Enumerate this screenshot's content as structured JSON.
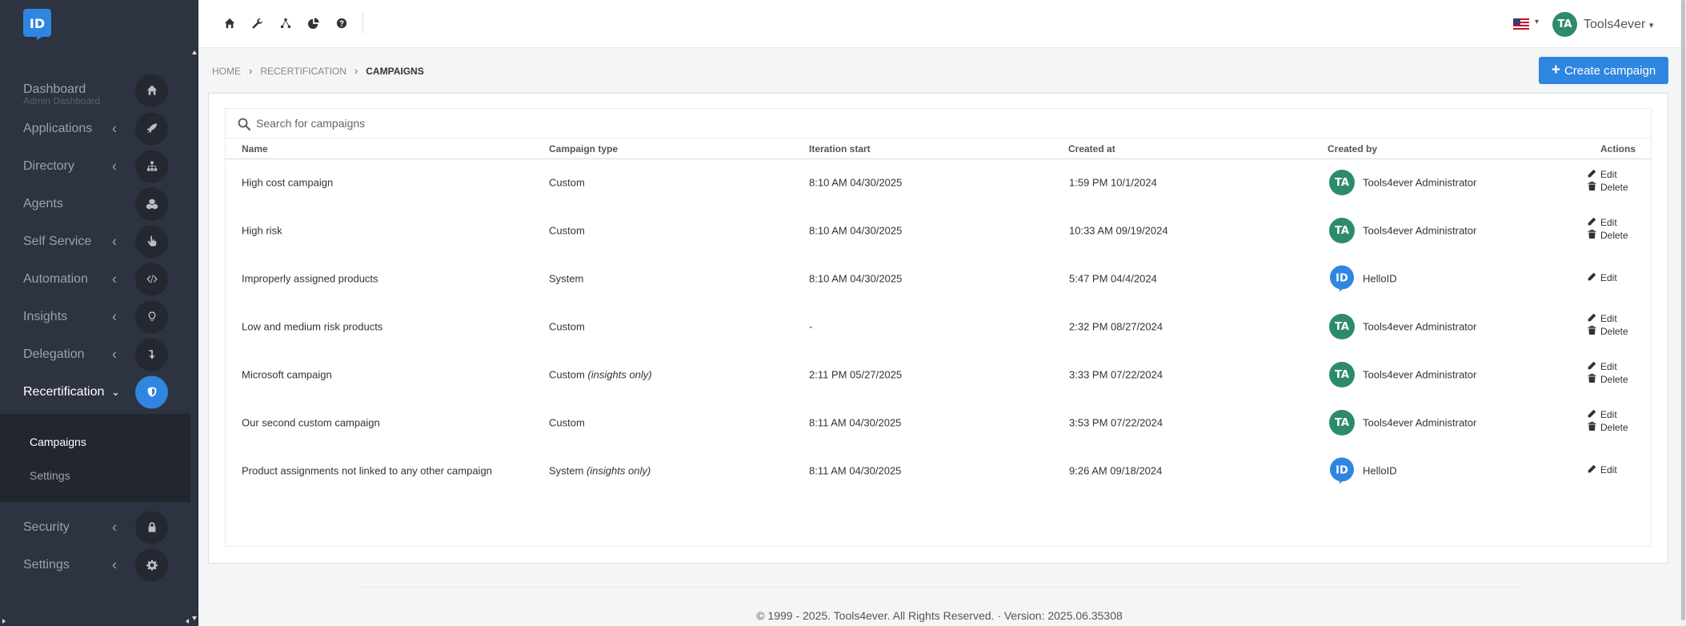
{
  "sidebar": {
    "logo_text": "ID",
    "items": [
      {
        "label": "Dashboard",
        "sub": "Admin Dashboard"
      },
      {
        "label": "Applications"
      },
      {
        "label": "Directory"
      },
      {
        "label": "Agents"
      },
      {
        "label": "Self Service"
      },
      {
        "label": "Automation"
      },
      {
        "label": "Insights"
      },
      {
        "label": "Delegation"
      },
      {
        "label": "Recertification"
      },
      {
        "label": "Security"
      },
      {
        "label": "Settings"
      }
    ],
    "submenu": [
      {
        "label": "Campaigns"
      },
      {
        "label": "Settings"
      }
    ]
  },
  "topbar": {
    "icons": [
      "home-icon",
      "wrench-icon",
      "share-icon",
      "chart-pie-icon",
      "help-icon"
    ],
    "user_initials": "TA",
    "user_name": "Tools4ever",
    "caret": "▾"
  },
  "breadcrumb": {
    "home": "HOME",
    "section": "RECERTIFICATION",
    "current": "CAMPAIGNS"
  },
  "create_button": {
    "label": "Create campaign",
    "icon": "+"
  },
  "search": {
    "placeholder": "Search for campaigns"
  },
  "table": {
    "headers": {
      "name": "Name",
      "type": "Campaign type",
      "iteration": "Iteration start",
      "created": "Created at",
      "by": "Created by",
      "actions": "Actions"
    },
    "rows": [
      {
        "name": "High cost campaign",
        "type": "Custom",
        "type_note": "",
        "iteration": "8:10 AM 04/30/2025",
        "created": "1:59 PM 10/1/2024",
        "initials": "TA",
        "by": "Tools4ever Administrator",
        "edit": "Edit",
        "delete": "Delete"
      },
      {
        "name": "High risk",
        "type": "Custom",
        "type_note": "",
        "iteration": "8:10 AM 04/30/2025",
        "created": "10:33 AM 09/19/2024",
        "initials": "TA",
        "by": "Tools4ever Administrator",
        "edit": "Edit",
        "delete": "Delete"
      },
      {
        "name": "Improperly assigned products",
        "type": "System",
        "type_note": "",
        "iteration": "8:10 AM 04/30/2025",
        "created": "5:47 PM 04/4/2024",
        "initials": "ID",
        "by": "HelloID",
        "edit": "Edit",
        "delete": ""
      },
      {
        "name": "Low and medium risk products",
        "type": "Custom",
        "type_note": "",
        "iteration": "-",
        "created": "2:32 PM 08/27/2024",
        "initials": "TA",
        "by": "Tools4ever Administrator",
        "edit": "Edit",
        "delete": "Delete"
      },
      {
        "name": "Microsoft campaign",
        "type": "Custom",
        "type_note": "(insights only)",
        "iteration": "2:11 PM 05/27/2025",
        "created": "3:33 PM 07/22/2024",
        "initials": "TA",
        "by": "Tools4ever Administrator",
        "edit": "Edit",
        "delete": "Delete"
      },
      {
        "name": "Our second custom campaign",
        "type": "Custom",
        "type_note": "",
        "iteration": "8:11 AM 04/30/2025",
        "created": "3:53 PM 07/22/2024",
        "initials": "TA",
        "by": "Tools4ever Administrator",
        "edit": "Edit",
        "delete": "Delete"
      },
      {
        "name": "Product assignments not linked to any other campaign",
        "type": "System",
        "type_note": "(insights only)",
        "iteration": "8:11 AM 04/30/2025",
        "created": "9:26 AM 09/18/2024",
        "initials": "ID",
        "by": "HelloID",
        "edit": "Edit",
        "delete": ""
      }
    ]
  },
  "footer": {
    "text": "© 1999 - 2025. Tools4ever. All Rights Reserved. · Version: 2025.06.35308"
  },
  "colors": {
    "accent": "#2f86e0",
    "sidebar_bg": "#2d3340",
    "avatar_green": "#2e8b6a"
  }
}
